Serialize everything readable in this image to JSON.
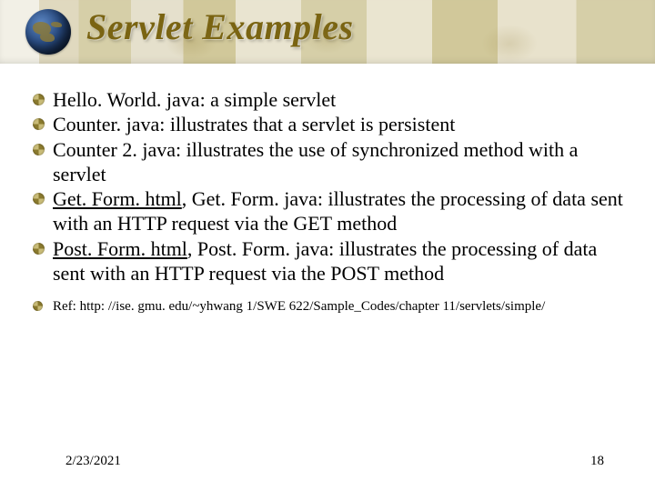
{
  "title": "Servlet Examples",
  "bullets": [
    {
      "text": "Hello. World. java: a simple servlet"
    },
    {
      "text": "Counter. java: illustrates that a servlet is persistent"
    },
    {
      "text": "Counter 2. java: illustrates the use of synchronized method with a servlet"
    },
    {
      "link": "Get. Form. html",
      "rest": ", Get. Form. java: illustrates the processing of data sent with an HTTP request via the GET method"
    },
    {
      "link": "Post. Form. html",
      "rest": ", Post. Form. java: illustrates the processing of data sent with an HTTP request via the POST method"
    }
  ],
  "ref_label": "Ref:  http: //ise. gmu. edu/~yhwang 1/SWE 622/Sample_Codes/chapter 11/servlets/simple/",
  "footer": {
    "date": "2/23/2021",
    "page": "18"
  }
}
